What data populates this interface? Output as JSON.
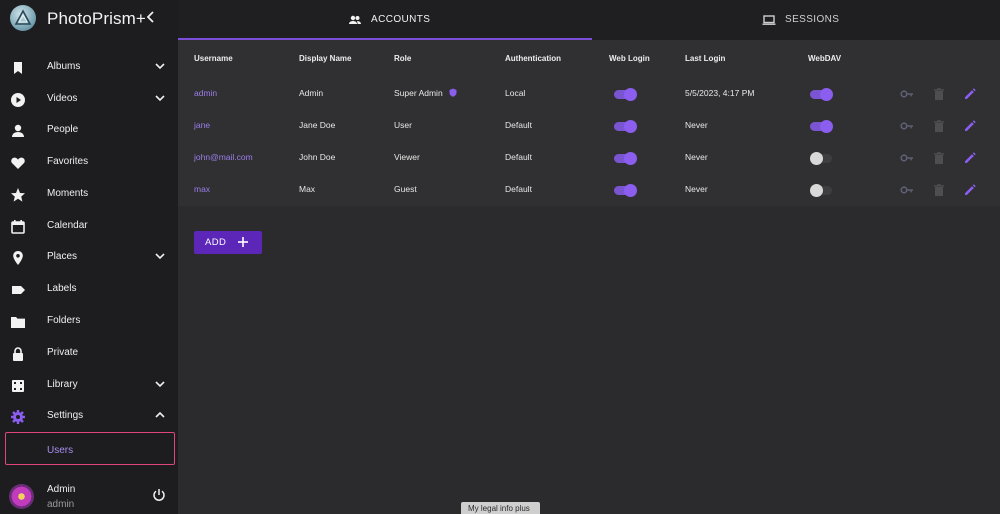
{
  "app": {
    "title": "PhotoPrism+"
  },
  "sidebar": {
    "items": [
      {
        "label": "Albums",
        "icon": "bookmark-icon",
        "expandable": true
      },
      {
        "label": "Videos",
        "icon": "play-circle-icon",
        "expandable": true
      },
      {
        "label": "People",
        "icon": "person-icon",
        "expandable": false
      },
      {
        "label": "Favorites",
        "icon": "heart-icon",
        "expandable": false
      },
      {
        "label": "Moments",
        "icon": "star-icon",
        "expandable": false
      },
      {
        "label": "Calendar",
        "icon": "calendar-icon",
        "expandable": false
      },
      {
        "label": "Places",
        "icon": "map-pin-icon",
        "expandable": true
      },
      {
        "label": "Labels",
        "icon": "label-icon",
        "expandable": false
      },
      {
        "label": "Folders",
        "icon": "folder-icon",
        "expandable": false
      },
      {
        "label": "Private",
        "icon": "lock-icon",
        "expandable": false
      },
      {
        "label": "Library",
        "icon": "film-icon",
        "expandable": true
      },
      {
        "label": "Settings",
        "icon": "gear-icon",
        "expandable": true
      }
    ],
    "sub_item": {
      "label": "Users"
    },
    "user": {
      "name": "Admin",
      "username": "admin"
    }
  },
  "tabs": [
    {
      "label": "ACCOUNTS",
      "icon": "people-icon",
      "active": true
    },
    {
      "label": "SESSIONS",
      "icon": "laptop-icon",
      "active": false
    }
  ],
  "table": {
    "headers": [
      "Username",
      "Display Name",
      "Role",
      "Authentication",
      "Web Login",
      "Last Login",
      "WebDAV"
    ],
    "rows": [
      {
        "username": "admin",
        "display_name": "Admin",
        "role": "Super Admin",
        "authentication": "Local",
        "web_login": true,
        "last_login": "5/5/2023, 4:17 PM",
        "webdav": true
      },
      {
        "username": "jane",
        "display_name": "Jane Doe",
        "role": "User",
        "authentication": "Default",
        "web_login": true,
        "last_login": "Never",
        "webdav": true
      },
      {
        "username": "john@mail.com",
        "display_name": "John Doe",
        "role": "Viewer",
        "authentication": "Default",
        "web_login": true,
        "last_login": "Never",
        "webdav": false
      },
      {
        "username": "max",
        "display_name": "Max",
        "role": "Guest",
        "authentication": "Default",
        "web_login": true,
        "last_login": "Never",
        "webdav": false
      }
    ]
  },
  "add_button": {
    "label": "ADD"
  },
  "footer": {
    "text": "My legal info plus"
  },
  "colors": {
    "accent": "#7c4dda",
    "button": "#5c27b8",
    "link": "#9b7de8",
    "highlight": "#e0457b"
  }
}
